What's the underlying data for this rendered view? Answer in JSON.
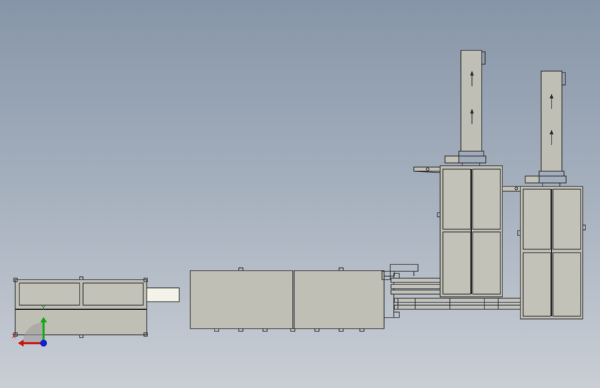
{
  "viewport": {
    "background_top": "#8695a8",
    "background_bottom": "#c9ced5"
  },
  "colors": {
    "machine_fill": "#bfbfb6",
    "panel_fill": "#c2c2b9",
    "outline": "#2a2a2a",
    "highlight_fill": "#f4f3ea",
    "axis_x": "#cc1111",
    "axis_y": "#11aa11",
    "axis_z": "#1122cc"
  },
  "triad": {
    "x_label": "X",
    "y_label": "Y"
  }
}
